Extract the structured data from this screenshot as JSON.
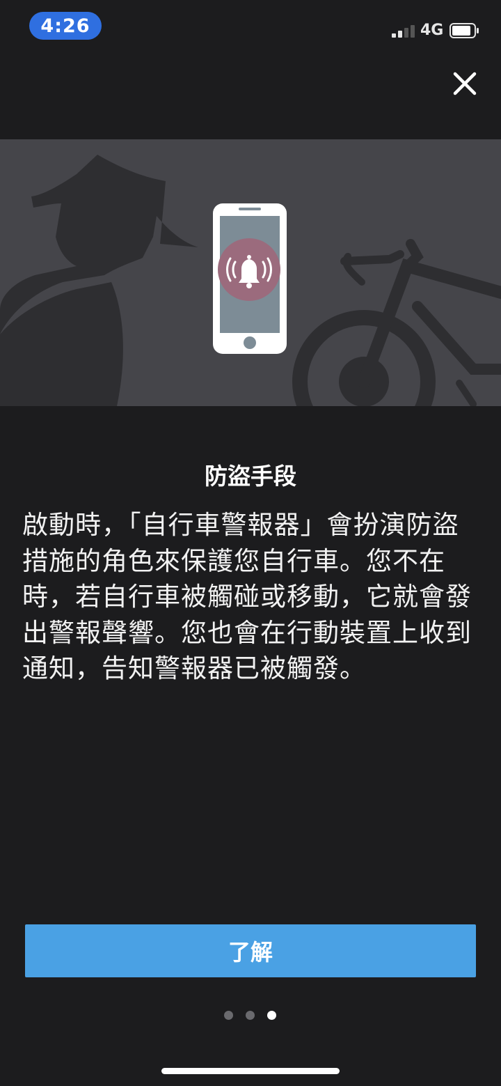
{
  "status_bar": {
    "time": "4:26",
    "network": "4G"
  },
  "icons": {
    "close": "close-icon",
    "bell": "bell-alarm-icon",
    "phone": "smartphone-icon"
  },
  "content": {
    "heading": "防盜手段",
    "body": "啟動時，「自行車警報器」會扮演防盜措施的角色來保護您自行車。您不在時，若自行車被觸碰或移動，它就會發出警報聲響。您也會在行動裝置上收到通知，告知警報器已被觸發。"
  },
  "actions": {
    "confirm_label": "了解"
  },
  "pager": {
    "total": 3,
    "current": 3
  },
  "colors": {
    "background": "#1c1c1e",
    "hero_background": "#45454a",
    "button": "#4aa1e4",
    "time_pill": "#2f6fe0",
    "bell_circle": "#9b6b7d"
  }
}
